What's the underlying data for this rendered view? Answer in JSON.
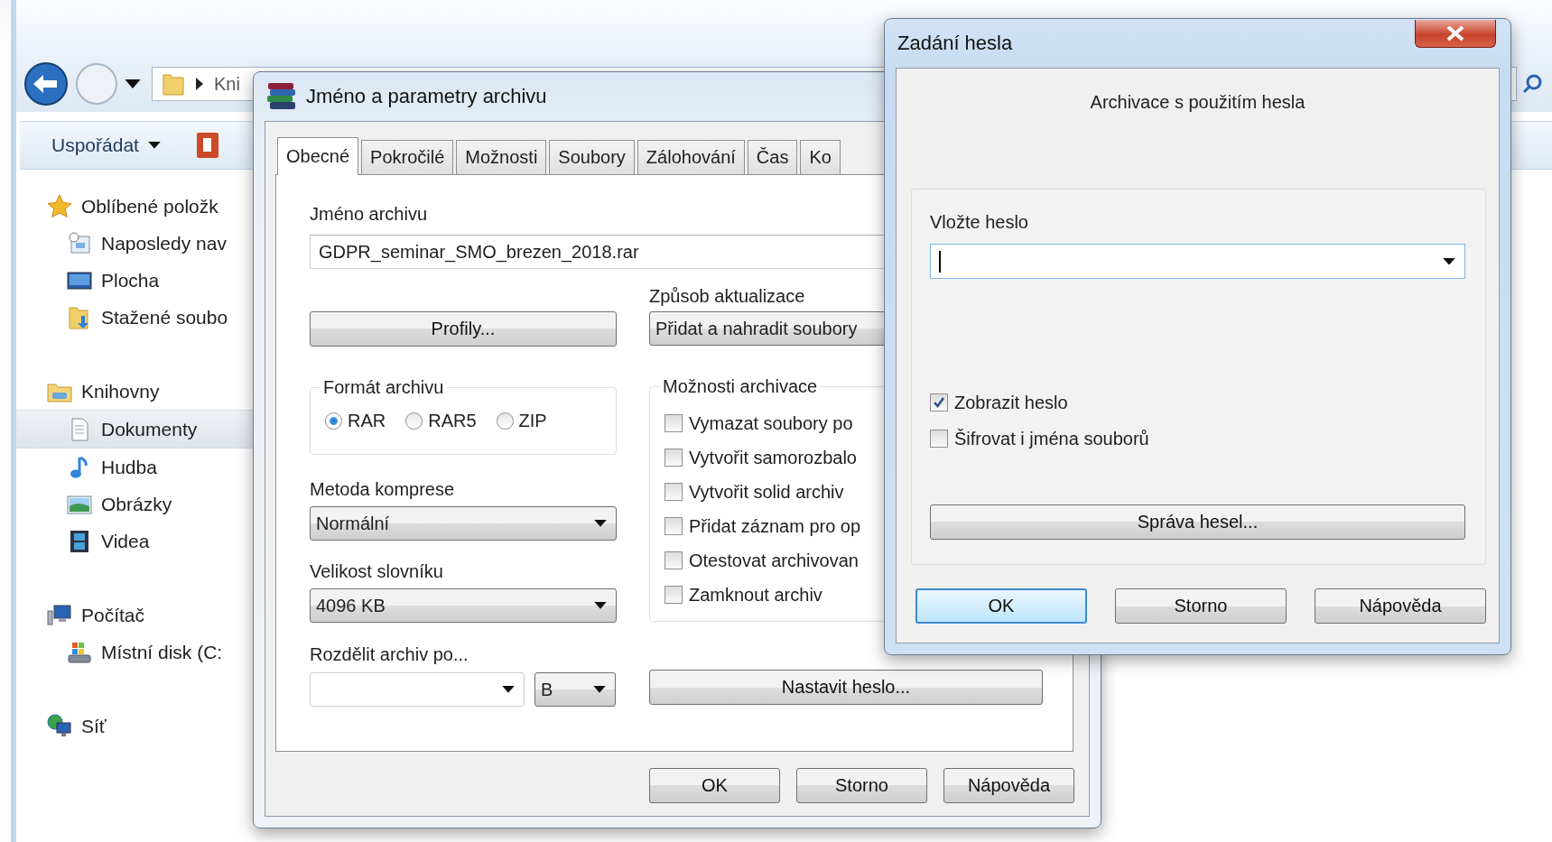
{
  "explorer": {
    "address": "Kni",
    "organize": "Uspořádat",
    "sidebar": [
      {
        "label": "Oblíbené položk",
        "selected": false,
        "children": [
          {
            "label": "Naposledy nav",
            "selected": false
          },
          {
            "label": "Plocha",
            "selected": false
          },
          {
            "label": "Stažené soubo",
            "selected": false
          }
        ]
      },
      {
        "label": "Knihovny",
        "selected": false,
        "children": [
          {
            "label": "Dokumenty",
            "selected": true
          },
          {
            "label": "Hudba",
            "selected": false
          },
          {
            "label": "Obrázky",
            "selected": false
          },
          {
            "label": "Videa",
            "selected": false
          }
        ]
      },
      {
        "label": "Počítač",
        "selected": false,
        "children": [
          {
            "label": "Místní disk (C:",
            "selected": false
          }
        ]
      },
      {
        "label": "Síť",
        "selected": false
      }
    ]
  },
  "archive_dialog": {
    "title": "Jméno a parametry archivu",
    "tabs": [
      {
        "label": "Obecné",
        "selected": true
      },
      {
        "label": "Pokročilé",
        "selected": false
      },
      {
        "label": "Možnosti",
        "selected": false
      },
      {
        "label": "Soubory",
        "selected": false
      },
      {
        "label": "Zálohování",
        "selected": false
      },
      {
        "label": "Čas",
        "selected": false
      },
      {
        "label": "Ko",
        "selected": false
      }
    ],
    "archive_name": {
      "label": "Jméno archivu",
      "value": "GDPR_seminar_SMO_brezen_2018.rar"
    },
    "profiles_button": "Profily...",
    "update_mode": {
      "label": "Způsob aktualizace",
      "value": "Přidat a nahradit soubory"
    },
    "format": {
      "label": "Formát archivu",
      "options": [
        {
          "label": "RAR",
          "selected": true
        },
        {
          "label": "RAR5",
          "selected": false
        },
        {
          "label": "ZIP",
          "selected": false
        }
      ]
    },
    "compression": {
      "label": "Metoda komprese",
      "value": "Normální"
    },
    "dictionary": {
      "label": "Velikost slovníku",
      "value": "4096 KB"
    },
    "split": {
      "label": "Rozdělit archiv po...",
      "unit": "B"
    },
    "options": {
      "label": "Možnosti archivace",
      "items": [
        {
          "label": "Vymazat soubory po",
          "checked": false
        },
        {
          "label": "Vytvořit samorozbalo",
          "checked": false
        },
        {
          "label": "Vytvořit solid archiv",
          "checked": false
        },
        {
          "label": "Přidat záznam pro op",
          "checked": false
        },
        {
          "label": "Otestovat archivovan",
          "checked": false
        },
        {
          "label": "Zamknout archiv",
          "checked": false
        }
      ]
    },
    "set_password_button": "Nastavit heslo...",
    "buttons": [
      {
        "label": "OK",
        "default": false
      },
      {
        "label": "Storno",
        "default": false
      },
      {
        "label": "Nápověda",
        "default": false
      }
    ]
  },
  "password_dialog": {
    "title": "Zadání hesla",
    "heading": "Archivace s použitím hesla",
    "password": {
      "label": "Vložte heslo"
    },
    "checkboxes": [
      {
        "label": "Zobrazit heslo",
        "checked": true
      },
      {
        "label": "Šifrovat i jména souborů",
        "checked": false
      }
    ],
    "manage_button": "Správa hesel...",
    "buttons": [
      {
        "label": "OK",
        "default": true
      },
      {
        "label": "Storno",
        "default": false
      },
      {
        "label": "Nápověda",
        "default": false
      }
    ]
  }
}
